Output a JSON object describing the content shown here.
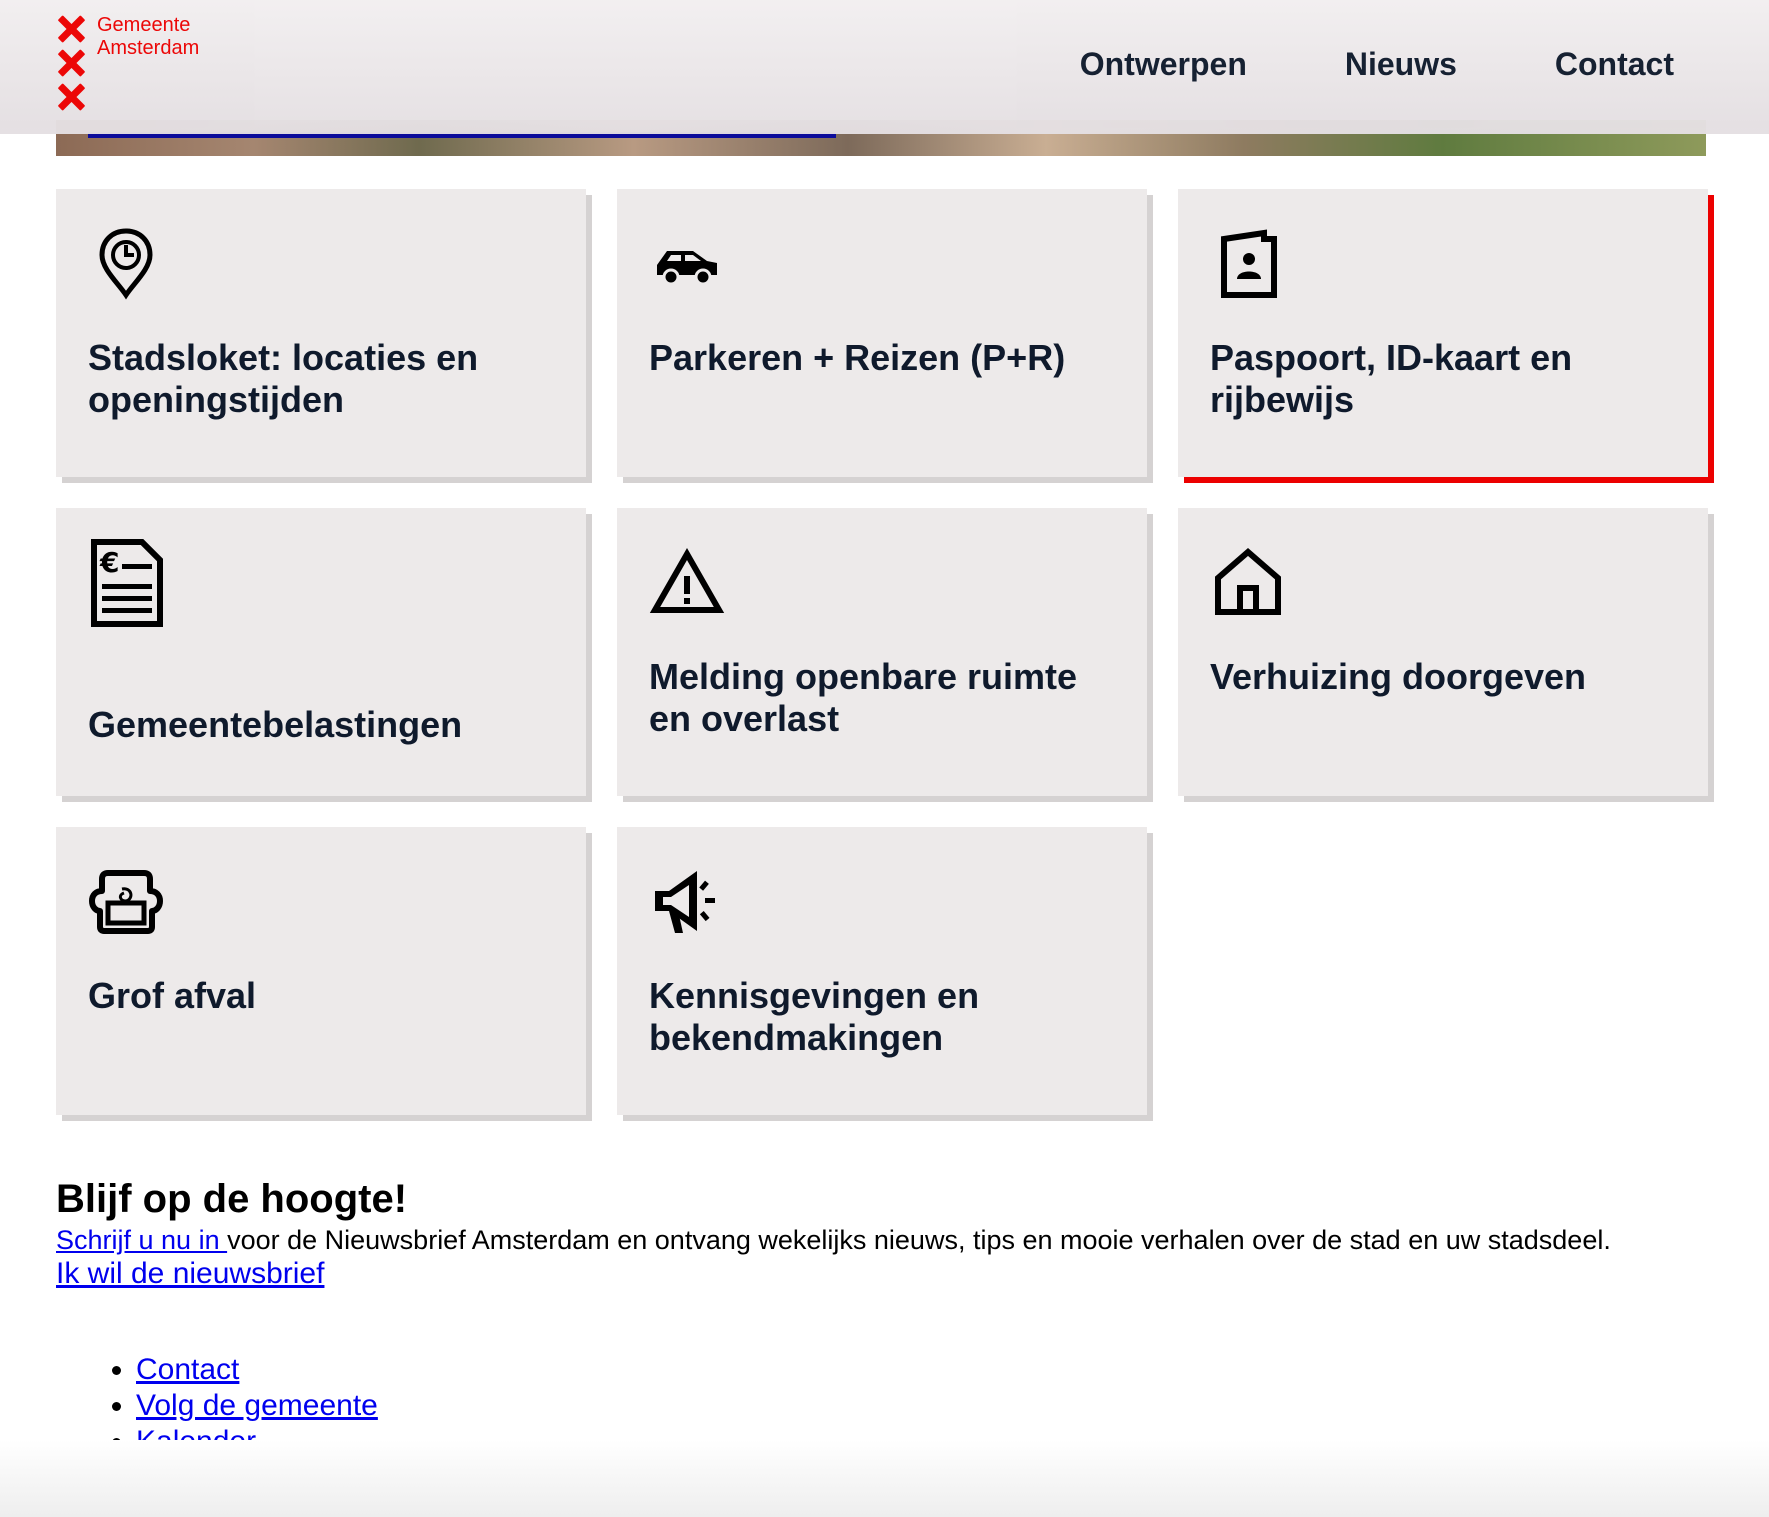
{
  "header": {
    "logo_line1": "Gemeente",
    "logo_line2": "Amsterdam",
    "nav": [
      "Ontwerpen",
      "Nieuws",
      "Contact"
    ]
  },
  "colors": {
    "brand_red": "#ec0000",
    "tile_bg": "#edeaea",
    "text_dark": "#0f1a2c",
    "link_blue": "#0000ee",
    "progress_blue": "#0b0b9a"
  },
  "tiles": [
    {
      "label": "Stadsloket: locaties en openingstijden",
      "icon": "location-clock-icon"
    },
    {
      "label": "Parkeren + Reizen (P+R)",
      "icon": "car-icon"
    },
    {
      "label": "Paspoort, ID-kaart en rijbewijs",
      "icon": "id-card-icon"
    },
    {
      "label": "Gemeentebelastingen",
      "icon": "tax-document-icon"
    },
    {
      "label": "Melding openbare ruimte en overlast",
      "icon": "warning-icon"
    },
    {
      "label": "Verhuizing doorgeven",
      "icon": "house-icon"
    },
    {
      "label": "Grof afval",
      "icon": "armchair-icon"
    },
    {
      "label": "Kennisgevingen en bekendmakingen",
      "icon": "megaphone-icon"
    }
  ],
  "newsletter": {
    "heading": "Blijf op de hoogte!",
    "link_text": "Schrijf u nu in ",
    "body_text": "voor de Nieuwsbrief Amsterdam en ontvang wekelijks nieuws, tips en mooie verhalen over de stad en uw stadsdeel.",
    "cta": "Ik wil de nieuwsbrief"
  },
  "footer_links": [
    "Contact",
    "Volg de gemeente",
    "Kalender"
  ]
}
